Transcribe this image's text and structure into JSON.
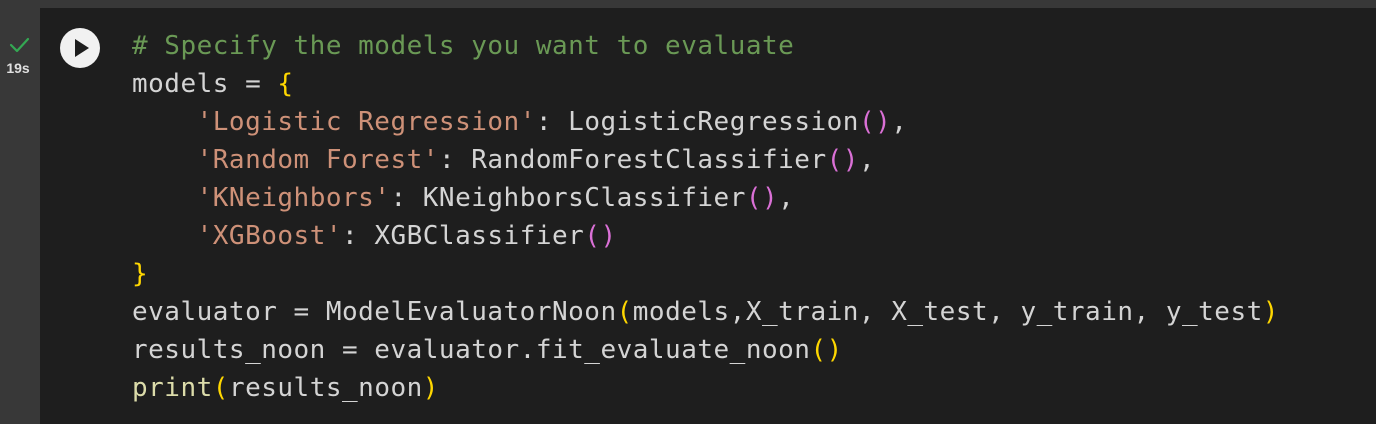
{
  "cell": {
    "status_icon": "check-icon",
    "exec_time": "19s",
    "run_icon": "play-icon",
    "colors": {
      "gutter": "#383838",
      "background": "#1e1e1e",
      "check": "#34a853",
      "comment": "#6a9955",
      "string": "#ce9178",
      "bracket_yellow": "#ffd700",
      "bracket_purple": "#da70d6"
    }
  },
  "code": {
    "l1": "# Specify the models you want to evaluate",
    "l2_a": "models = ",
    "l2_b": "{",
    "l3_a": "    ",
    "l3_b": "'Logistic Regression'",
    "l3_c": ": LogisticRegression",
    "l3_d": "()",
    "l3_e": ",",
    "l4_a": "    ",
    "l4_b": "'Random Forest'",
    "l4_c": ": RandomForestClassifier",
    "l4_d": "()",
    "l4_e": ",",
    "l5_a": "    ",
    "l5_b": "'KNeighbors'",
    "l5_c": ": KNeighborsClassifier",
    "l5_d": "()",
    "l5_e": ",",
    "l6_a": "    ",
    "l6_b": "'XGBoost'",
    "l6_c": ": XGBClassifier",
    "l6_d": "()",
    "l7": "}",
    "l8_a": "evaluator = ModelEvaluatorNoon",
    "l8_b": "(",
    "l8_c": "models,X_train, X_test, y_train, y_test",
    "l8_d": ")",
    "l9_a": "results_noon = evaluator.fit_evaluate_noon",
    "l9_b": "()",
    "l10_a": "print",
    "l10_b": "(",
    "l10_c": "results_noon",
    "l10_d": ")"
  }
}
